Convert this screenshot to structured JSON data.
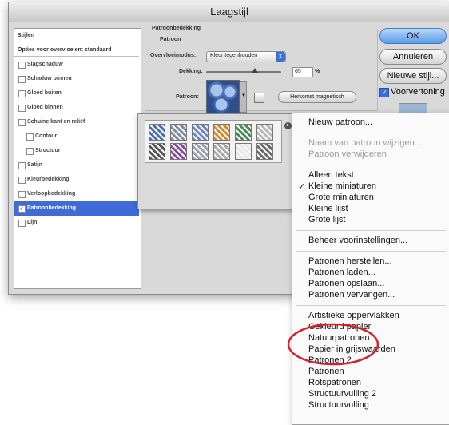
{
  "window": {
    "title": "Laagstijl"
  },
  "stylelist": {
    "header": "Stijlen",
    "options": "Opties voor overvloeien: standaard",
    "items": [
      {
        "label": "Slagschaduw",
        "checked": false,
        "indent": 0
      },
      {
        "label": "Schaduw binnen",
        "checked": false,
        "indent": 0
      },
      {
        "label": "Gloed buiten",
        "checked": false,
        "indent": 0
      },
      {
        "label": "Gloed binnen",
        "checked": false,
        "indent": 0
      },
      {
        "label": "Schuine kant en reliëf",
        "checked": false,
        "indent": 0
      },
      {
        "label": "Contour",
        "checked": false,
        "indent": 1
      },
      {
        "label": "Structuur",
        "checked": false,
        "indent": 1
      },
      {
        "label": "Satijn",
        "checked": false,
        "indent": 0
      },
      {
        "label": "Kleurbedekking",
        "checked": false,
        "indent": 0
      },
      {
        "label": "Verloopbedekking",
        "checked": false,
        "indent": 0
      },
      {
        "label": "Patroonbedekking",
        "checked": true,
        "indent": 0,
        "selected": true
      },
      {
        "label": "Lijn",
        "checked": false,
        "indent": 0
      }
    ]
  },
  "panel": {
    "group_title": "Patroonbedekking",
    "sub_title": "Patroon",
    "blend_label": "Overvloeimodus:",
    "blend_value": "Kleur tegenhouden",
    "opacity_label": "Dekking:",
    "opacity_value": "65",
    "opacity_unit": "%",
    "opacity_level": 0.65,
    "pattern_label": "Patroon:",
    "snap_button": "Herkomst magnetisch"
  },
  "buttons": {
    "ok": "OK",
    "cancel": "Annuleren",
    "new_style": "Nieuwe stijl...",
    "preview_label": "Voorvertoning",
    "preview_checked": true
  },
  "picker": {
    "thumbs": [
      "#4a6fb0",
      "#7d8aa0",
      "#6b86c8",
      "#d48a2a",
      "#4c8a56",
      "#b8b8b8",
      "#555555",
      "#8a4a9a",
      "#9aa0b0",
      "#a8a8a8",
      "#e8e8e8",
      "#6a6a6a"
    ]
  },
  "menu": {
    "items": [
      {
        "label": "Nieuw patroon...",
        "disabled": false
      },
      {
        "sep": true
      },
      {
        "label": "Naam van patroon wijzigen...",
        "disabled": true
      },
      {
        "label": "Patroon verwijderen",
        "disabled": true
      },
      {
        "sep": true
      },
      {
        "label": "Alleen tekst",
        "disabled": false
      },
      {
        "label": "Kleine miniaturen",
        "disabled": false,
        "checked": true
      },
      {
        "label": "Grote miniaturen",
        "disabled": false
      },
      {
        "label": "Kleine lijst",
        "disabled": false
      },
      {
        "label": "Grote lijst",
        "disabled": false
      },
      {
        "sep": true
      },
      {
        "label": "Beheer voorinstellingen...",
        "disabled": false
      },
      {
        "sep": true
      },
      {
        "label": "Patronen herstellen...",
        "disabled": false
      },
      {
        "label": "Patronen laden...",
        "disabled": false
      },
      {
        "label": "Patronen opslaan...",
        "disabled": false
      },
      {
        "label": "Patronen vervangen...",
        "disabled": false
      },
      {
        "sep": true
      },
      {
        "label": "Artistieke oppervlakken",
        "disabled": false
      },
      {
        "label": "Gekleurd papier",
        "disabled": false
      },
      {
        "label": "Natuurpatronen",
        "disabled": false,
        "highlighted": true
      },
      {
        "label": "Papier in grijswaarden",
        "disabled": false
      },
      {
        "label": "Patronen 2",
        "disabled": false
      },
      {
        "label": "Patronen",
        "disabled": false
      },
      {
        "label": "Rotspatronen",
        "disabled": false
      },
      {
        "label": "Structuurvulling 2",
        "disabled": false
      },
      {
        "label": "Structuurvulling",
        "disabled": false
      }
    ]
  },
  "colors": {
    "selection": "#3f6bd8",
    "highlight_circle": "#d6202a"
  }
}
